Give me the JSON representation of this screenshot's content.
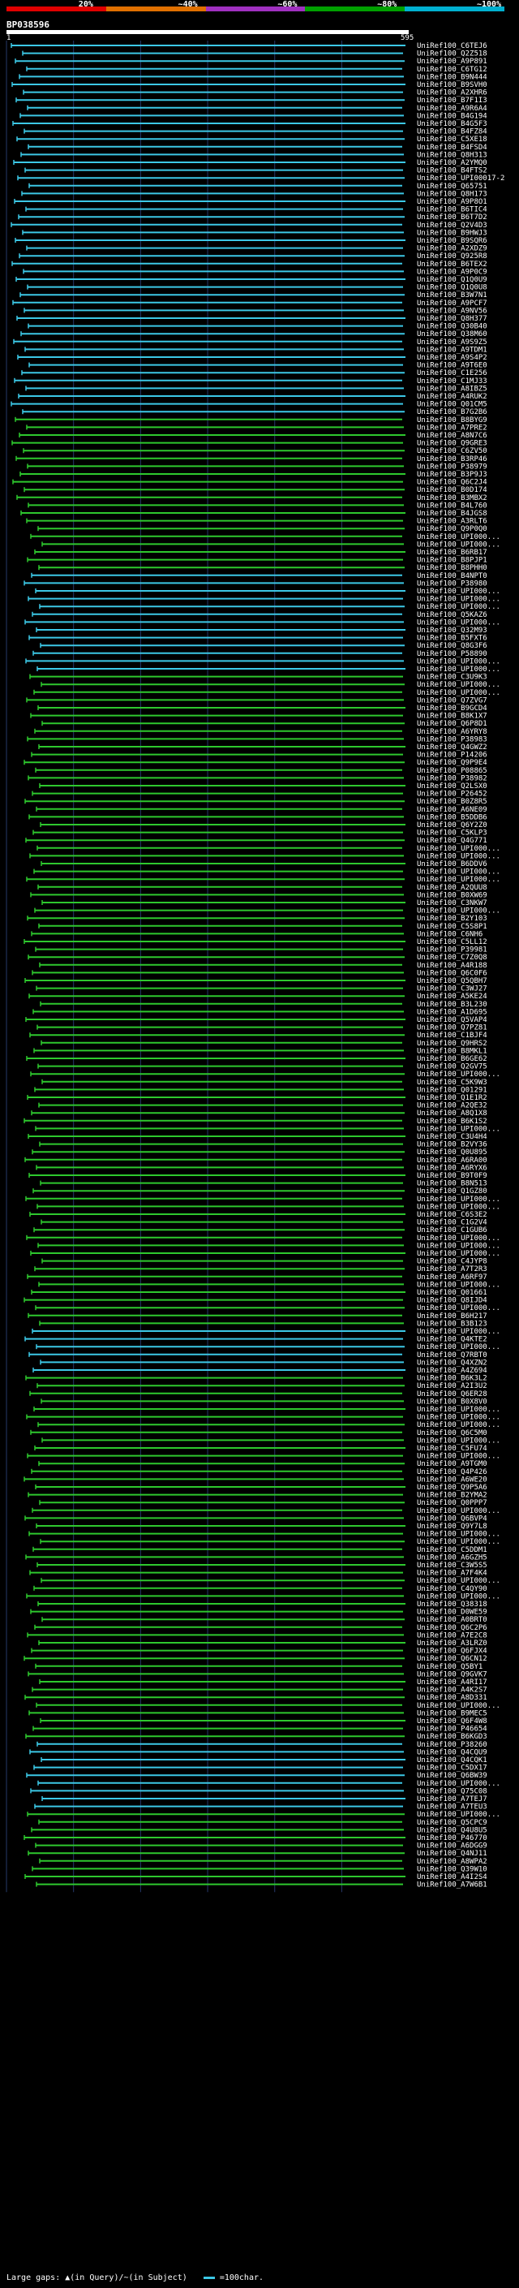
{
  "header": {
    "scale_labels": [
      "20%",
      "~40%",
      "~60%",
      "~80%",
      "~100%"
    ],
    "scale_colors": [
      "#e00000",
      "#e07000",
      "#a030c0",
      "#00a000",
      "#00b0d0"
    ],
    "query_id": "BP038596",
    "tick_start": "1",
    "tick_end": "595"
  },
  "colors": {
    "green": "#2ec82e",
    "cyan": "#3cc8e6",
    "background": "#000000",
    "grid": "#263a6a"
  },
  "footer": {
    "text": "Large gaps: ▲(in Query)/~(in Subject)",
    "legend_label": "=100char."
  },
  "chart_data": {
    "type": "bar",
    "query_length": 595,
    "xlim": [
      1,
      595
    ],
    "series": [
      {
        "name": "cyan",
        "rows": "0-47,68-80,165-170,218-226"
      },
      {
        "name": "green",
        "rows": "rest"
      }
    ],
    "labels": [
      "UniRef100_C6TEJ6",
      "UniRef100_Q2Z518",
      "UniRef100_A9P891",
      "UniRef100_C6TG12",
      "UniRef100_B9N444",
      "UniRef100_B9SVH0",
      "UniRef100_A2XHR6",
      "UniRef100_B7F1I3",
      "UniRef100_A9R6A4",
      "UniRef100_B4G194",
      "UniRef100_B4G5F3",
      "UniRef100_B4FZ84",
      "UniRef100_C5XE18",
      "UniRef100_B4FSD4",
      "UniRef100_Q8H313",
      "UniRef100_A2YMQ0",
      "UniRef100_B4FTS2",
      "UniRef100_UPI00017-2",
      "UniRef100_Q65751",
      "UniRef100_Q8H173",
      "UniRef100_A9P8O1",
      "UniRef100_B6TIC4",
      "UniRef100_B6T7D2",
      "UniRef100_Q2V4D3",
      "UniRef100_B9HWJ3",
      "UniRef100_B9SQR6",
      "UniRef100_A2XDZ9",
      "UniRef100_Q925R8",
      "UniRef100_B6TEX2",
      "UniRef100_A9P0C9",
      "UniRef100_Q1Q0U9",
      "UniRef100_Q1Q0U8",
      "UniRef100_B3W7N1",
      "UniRef100_A9PCF7",
      "UniRef100_A9NV56",
      "UniRef100_Q8H377",
      "UniRef100_Q30B40",
      "UniRef100_Q38M60",
      "UniRef100_A9S9Z5",
      "UniRef100_A9TDM1",
      "UniRef100_A9S4P2",
      "UniRef100_A9T6E0",
      "UniRef100_C1E256",
      "UniRef100_C1MJ33",
      "UniRef100_A8IBZ5",
      "UniRef100_A4RUK2",
      "UniRef100_Q01CM5",
      "UniRef100_B7G2B6",
      "UniRef100_B8BYG9",
      "UniRef100_A7PRE2",
      "UniRef100_A8N7C6",
      "UniRef100_Q9GRE3",
      "UniRef100_C6ZV50",
      "UniRef100_B3RP46",
      "UniRef100_P38979",
      "UniRef100_B3P9J3",
      "UniRef100_Q6C2J4",
      "UniRef100_B0D174",
      "UniRef100_B3MBX2",
      "UniRef100_B4L760",
      "UniRef100_B4JGS8",
      "UniRef100_A3RLT6",
      "UniRef100_Q9P0Q0",
      "UniRef100_UPI000...",
      "UniRef100_UPI000...",
      "UniRef100_B6RB17",
      "UniRef100_B8PJP1",
      "UniRef100_B8PHH0",
      "UniRef100_B4NPT0",
      "UniRef100_P38980",
      "UniRef100_UPI000...",
      "UniRef100_UPI000...",
      "UniRef100_UPI000...",
      "UniRef100_Q5KAZ6",
      "UniRef100_UPI000...",
      "UniRef100_Q32M93",
      "UniRef100_B5FXT6",
      "UniRef100_Q8G3F6",
      "UniRef100_P58890",
      "UniRef100_UPI000...",
      "UniRef100_UPI000...",
      "UniRef100_C3U9K3",
      "UniRef100_UPI000...",
      "UniRef100_UPI000...",
      "UniRef100_Q7ZVG7",
      "UniRef100_B9GCD4",
      "UniRef100_B8K1X7",
      "UniRef100_Q6P8D1",
      "UniRef100_A6YRY8",
      "UniRef100_P38983",
      "UniRef100_Q4GWZ2",
      "UniRef100_P14206",
      "UniRef100_Q9P9E4",
      "UniRef100_P08865",
      "UniRef100_P38982",
      "UniRef100_Q2LSX0",
      "UniRef100_P26452",
      "UniRef100_B0Z8R5",
      "UniRef100_A6NE09",
      "UniRef100_B5DDB6",
      "UniRef100_Q6Y2Z0",
      "UniRef100_C5KLP3",
      "UniRef100_Q4G771",
      "UniRef100_UPI000...",
      "UniRef100_UPI000...",
      "UniRef100_B6DDV6",
      "UniRef100_UPI000...",
      "UniRef100_UPI000...",
      "UniRef100_A2QUU8",
      "UniRef100_B0XW69",
      "UniRef100_C3NKW7",
      "UniRef100_UPI000...",
      "UniRef100_B2Y103",
      "UniRef100_C5S8P1",
      "UniRef100_C6NH6",
      "UniRef100_C5LL12",
      "UniRef100_P39981",
      "UniRef100_C7Z0Q8",
      "UniRef100_A4R188",
      "UniRef100_Q6C0F6",
      "UniRef100_Q5QBH7",
      "UniRef100_C3WJ27",
      "UniRef100_A5KE24",
      "UniRef100_B3L230",
      "UniRef100_A1D695",
      "UniRef100_Q5VAP4",
      "UniRef100_Q7PZ81",
      "UniRef100_C1BJF4",
      "UniRef100_Q9HRS2",
      "UniRef100_B8MKL1",
      "UniRef100_B6GE62",
      "UniRef100_Q2GV75",
      "UniRef100_UPI000...",
      "UniRef100_C5K9W3",
      "UniRef100_Q01291",
      "UniRef100_Q1E1R2",
      "UniRef100_A2QE32",
      "UniRef100_A8Q1X8",
      "UniRef100_B6K1S2",
      "UniRef100_UPI000...",
      "UniRef100_C3U4H4",
      "UniRef100_B2VY36",
      "UniRef100_Q0U895",
      "UniRef100_A6RA00",
      "UniRef100_A6RYX6",
      "UniRef100_B9T0F9",
      "UniRef100_B8N513",
      "UniRef100_Q1GZ80",
      "UniRef100_UPI000...",
      "UniRef100_UPI000...",
      "UniRef100_C6S3E2",
      "UniRef100_C1G2V4",
      "UniRef100_C1GUB6",
      "UniRef100_UPI000...",
      "UniRef100_UPI000...",
      "UniRef100_UPI000...",
      "UniRef100_C4JYP8",
      "UniRef100_A7T2R3",
      "UniRef100_A6RF97",
      "UniRef100_UPI000...",
      "UniRef100_Q01661",
      "UniRef100_Q8IJD4",
      "UniRef100_UPI000...",
      "UniRef100_B6H217",
      "UniRef100_B3B123",
      "UniRef100_UPI000...",
      "UniRef100_Q4KTE2",
      "UniRef100_UPI000...",
      "UniRef100_Q7RBT0",
      "UniRef100_Q4XZN2",
      "UniRef100_A4Z694",
      "UniRef100_B6K3L2",
      "UniRef100_A2I3U2",
      "UniRef100_Q6ER28",
      "UniRef100_B0X8V0",
      "UniRef100_UPI000...",
      "UniRef100_UPI000...",
      "UniRef100_UPI000...",
      "UniRef100_Q6C5M0",
      "UniRef100_UPI000...",
      "UniRef100_C5FU74",
      "UniRef100_UPI000...",
      "UniRef100_A9TGM0",
      "UniRef100_Q4P426",
      "UniRef100_A6WE20",
      "UniRef100_Q9P5A6",
      "UniRef100_B2YMA2",
      "UniRef100_Q0PPP7",
      "UniRef100_UPI000...",
      "UniRef100_Q6BVP4",
      "UniRef100_Q9Y7L8",
      "UniRef100_UPI000...",
      "UniRef100_UPI000...",
      "UniRef100_C5DDM1",
      "UniRef100_A6GZH5",
      "UniRef100_C3W5S5",
      "UniRef100_A7F4K4",
      "UniRef100_UPI000...",
      "UniRef100_C4QY90",
      "UniRef100_UPI000...",
      "UniRef100_Q38318",
      "UniRef100_D0WE59",
      "UniRef100_A0BRT0",
      "UniRef100_Q6C2P6",
      "UniRef100_A7E2C8",
      "UniRef100_A3LRZ0",
      "UniRef100_Q6FJX4",
      "UniRef100_Q6CN12",
      "UniRef100_Q5BY1",
      "UniRef100_Q9GVK7",
      "UniRef100_A4RI17",
      "UniRef100_A4K2S7",
      "UniRef100_A8D331",
      "UniRef100_UPI000...",
      "UniRef100_B9MEC5",
      "UniRef100_Q6F4W8",
      "UniRef100_P46654",
      "UniRef100_B6KGD3",
      "UniRef100_P38260",
      "UniRef100_Q4CQU9",
      "UniRef100_Q4CQK1",
      "UniRef100_C5DX17",
      "UniRef100_Q6BW39",
      "UniRef100_UPI000...",
      "UniRef100_Q75C08",
      "UniRef100_A7TEJ7",
      "UniRef100_A7TEU3",
      "UniRef100_UPI000...",
      "UniRef100_Q5CPC9",
      "UniRef100_Q4U8U5",
      "UniRef100_P46770",
      "UniRef100_A6DGG9",
      "UniRef100_Q4NJ11",
      "UniRef100_A8WPA2",
      "UniRef100_Q39W10",
      "UniRef100_A4I2S4",
      "UniRef100_A7W6B1"
    ]
  }
}
